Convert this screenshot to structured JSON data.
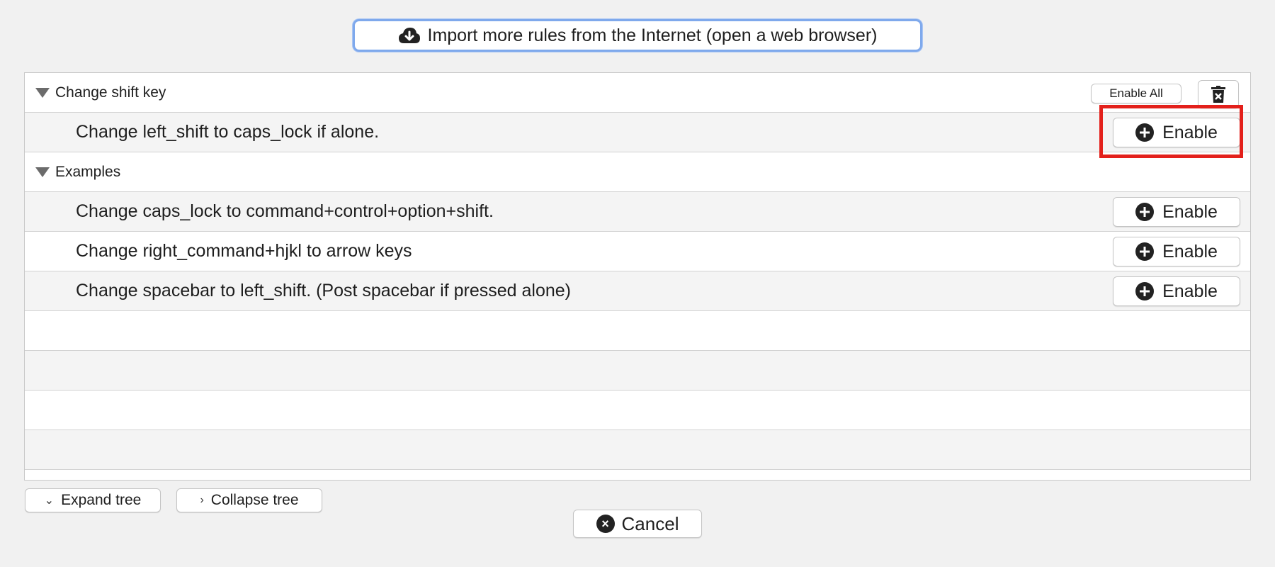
{
  "import_button": {
    "label": "Import more rules from the Internet (open a web browser)",
    "icon": "cloud-download-icon"
  },
  "groups": [
    {
      "title": "Change shift key",
      "enable_all_label": "Enable All",
      "rules": [
        {
          "text": "Change left_shift to caps_lock if alone.",
          "button": "Enable"
        }
      ]
    },
    {
      "title": "Examples",
      "rules": [
        {
          "text": "Change caps_lock to command+control+option+shift.",
          "button": "Enable"
        },
        {
          "text": "Change right_command+hjkl to arrow keys",
          "button": "Enable"
        },
        {
          "text": "Change spacebar to left_shift. (Post spacebar if pressed alone)",
          "button": "Enable"
        }
      ]
    }
  ],
  "footer": {
    "expand_label": "Expand tree",
    "collapse_label": "Collapse tree",
    "cancel_label": "Cancel"
  },
  "colors": {
    "highlight": "#e3201b",
    "focus_ring": "#7fa9ec"
  }
}
